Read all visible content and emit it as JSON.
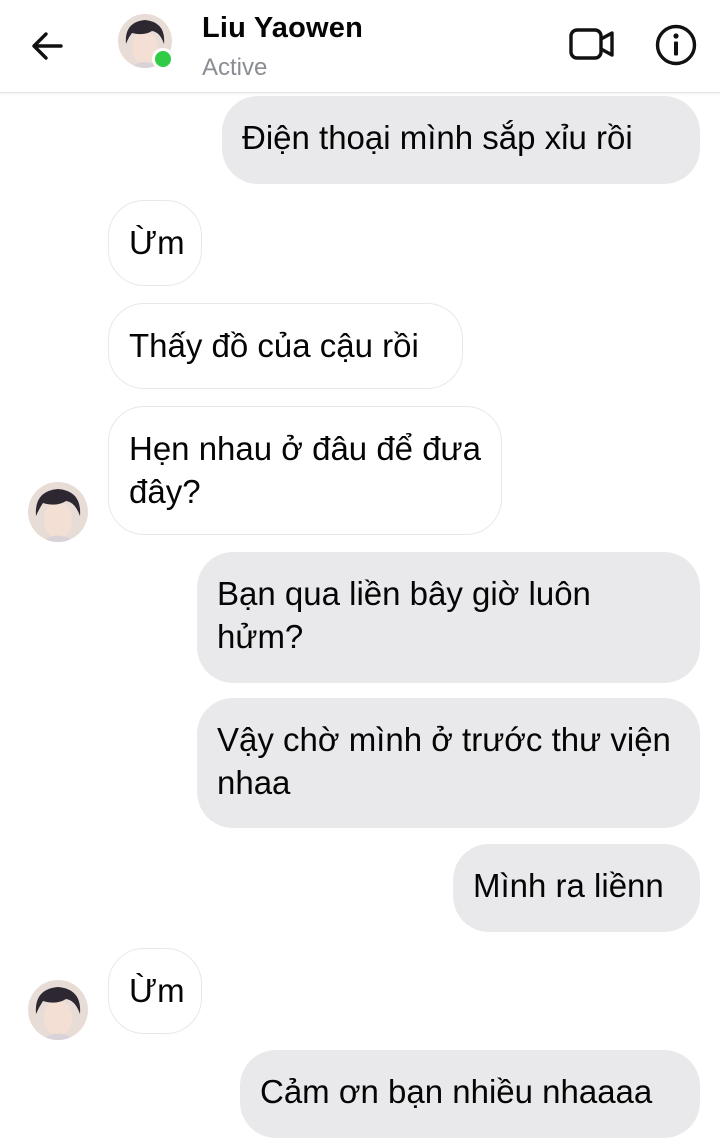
{
  "header": {
    "back_icon": "arrow-left-icon",
    "contact_name": "Liu Yaowen",
    "status": "Active",
    "online_color": "#31cc46",
    "video_icon": "video-camera-icon",
    "info_icon": "info-circle-icon"
  },
  "messages": [
    {
      "side": "out",
      "text": "Điện thoại mình sắp xỉu rồi"
    },
    {
      "side": "in",
      "text": "Ừm"
    },
    {
      "side": "in",
      "text": "Thấy đồ của cậu rồi"
    },
    {
      "side": "in",
      "text": "Hẹn nhau ở đâu để đưa đây?"
    },
    {
      "side": "out",
      "text": "Bạn qua liền bây giờ luôn hửm?"
    },
    {
      "side": "out",
      "text": "Vậy chờ mình ở trước thư viện nhaa"
    },
    {
      "side": "out",
      "text": "Mình ra liềnn"
    },
    {
      "side": "in",
      "text": "Ừm"
    },
    {
      "side": "out",
      "text": "Cảm ơn bạn nhiều nhaaaa"
    }
  ],
  "colors": {
    "outgoing_bubble": "#e9e9eb",
    "incoming_bubble": "#ffffff"
  }
}
